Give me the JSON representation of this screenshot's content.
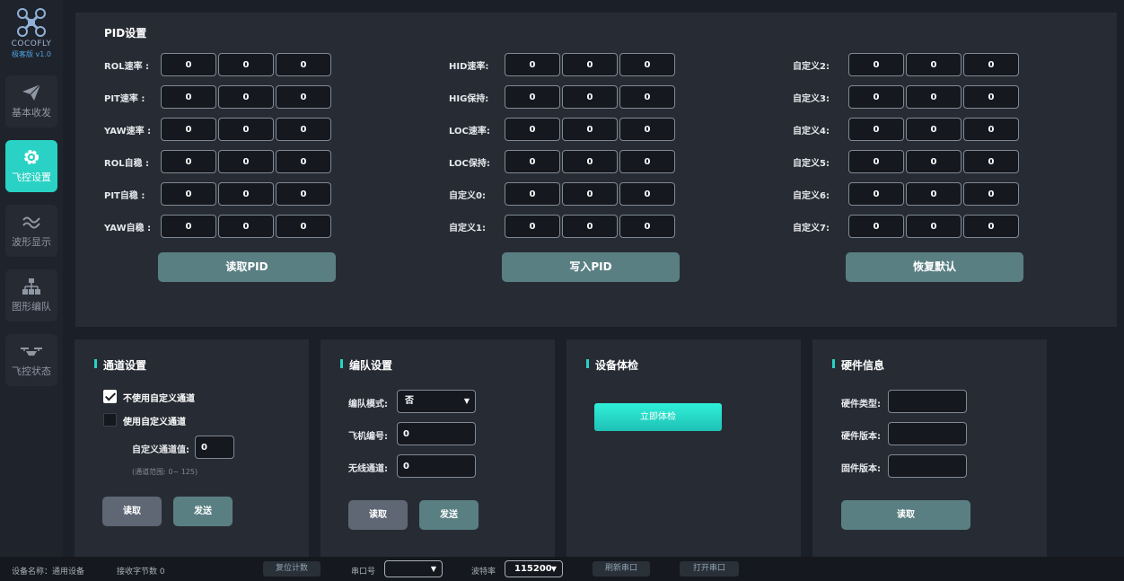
{
  "sidebar": {
    "brand": "COCOFLY",
    "version": "极客版 v1.0",
    "items": [
      {
        "label": "基本收发",
        "icon": "paper-plane-icon"
      },
      {
        "label": "飞控设置",
        "icon": "gear-icon"
      },
      {
        "label": "波形显示",
        "icon": "wave-icon"
      },
      {
        "label": "图形编队",
        "icon": "hierarchy-icon"
      },
      {
        "label": "飞控状态",
        "icon": "drone-icon"
      }
    ],
    "active_index": 1
  },
  "pid": {
    "title": "PID设置",
    "columns": [
      {
        "rows": [
          {
            "label": "ROL速率 :",
            "values": [
              "0",
              "0",
              "0"
            ]
          },
          {
            "label": "PIT速率 :",
            "values": [
              "0",
              "0",
              "0"
            ]
          },
          {
            "label": "YAW速率 :",
            "values": [
              "0",
              "0",
              "0"
            ]
          },
          {
            "label": "ROL自稳 :",
            "values": [
              "0",
              "0",
              "0"
            ]
          },
          {
            "label": "PIT自稳 :",
            "values": [
              "0",
              "0",
              "0"
            ]
          },
          {
            "label": "YAW自稳 :",
            "values": [
              "0",
              "0",
              "0"
            ]
          }
        ]
      },
      {
        "rows": [
          {
            "label": "HID速率:",
            "values": [
              "0",
              "0",
              "0"
            ]
          },
          {
            "label": "HIG保持:",
            "values": [
              "0",
              "0",
              "0"
            ]
          },
          {
            "label": "LOC速率:",
            "values": [
              "0",
              "0",
              "0"
            ]
          },
          {
            "label": "LOC保持:",
            "values": [
              "0",
              "0",
              "0"
            ]
          },
          {
            "label": "自定义0:",
            "values": [
              "0",
              "0",
              "0"
            ]
          },
          {
            "label": "自定义1:",
            "values": [
              "0",
              "0",
              "0"
            ]
          }
        ]
      },
      {
        "rows": [
          {
            "label": "自定义2:",
            "values": [
              "0",
              "0",
              "0"
            ]
          },
          {
            "label": "自定义3:",
            "values": [
              "0",
              "0",
              "0"
            ]
          },
          {
            "label": "自定义4:",
            "values": [
              "0",
              "0",
              "0"
            ]
          },
          {
            "label": "自定义5:",
            "values": [
              "0",
              "0",
              "0"
            ]
          },
          {
            "label": "自定义6:",
            "values": [
              "0",
              "0",
              "0"
            ]
          },
          {
            "label": "自定义7:",
            "values": [
              "0",
              "0",
              "0"
            ]
          }
        ]
      }
    ],
    "read_label": "读取PID",
    "write_label": "写入PID",
    "reset_label": "恢复默认"
  },
  "channel": {
    "title": "通道设置",
    "option1": "不使用自定义通道",
    "option1_checked": true,
    "option2": "使用自定义通道",
    "option2_checked": false,
    "value_label": "自定义通道值:",
    "value": "0",
    "hint": "(通道范围: 0~ 125)",
    "read_label": "读取",
    "send_label": "发送"
  },
  "formation": {
    "title": "编队设置",
    "mode_label": "编队模式:",
    "mode_value": "否",
    "id_label": "飞机编号:",
    "id_value": "0",
    "radio_label": "无线通道:",
    "radio_value": "0",
    "read_label": "读取",
    "send_label": "发送"
  },
  "device_check": {
    "title": "设备体检",
    "button_label": "立即体检"
  },
  "hardware": {
    "title": "硬件信息",
    "type_label": "硬件类型:",
    "type_value": "",
    "hw_version_label": "硬件版本:",
    "hw_version_value": "",
    "fw_version_label": "固件版本:",
    "fw_version_value": "",
    "read_label": "读取"
  },
  "statusbar": {
    "device_name": "设备名称：通用设备",
    "bytes_received": "接收字节数 0",
    "reset_count_label": "复位计数",
    "port_label": "串口号",
    "port_value": "",
    "baud_label": "波特率",
    "baud_value": "115200",
    "refresh_label": "刷新串口",
    "open_label": "打开串口"
  },
  "colors": {
    "accent": "#29d2c4",
    "panel": "#272c34",
    "background": "#1b1f27",
    "button_teal": "#5a7f83"
  }
}
